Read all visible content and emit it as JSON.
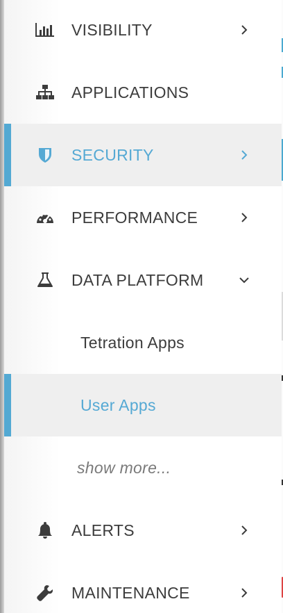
{
  "nav": {
    "items": [
      {
        "label": "VISIBILITY",
        "icon": "bar-chart-icon",
        "chevron": "right"
      },
      {
        "label": "APPLICATIONS",
        "icon": "sitemap-icon",
        "chevron": "none"
      },
      {
        "label": "SECURITY",
        "icon": "shield-icon",
        "chevron": "right",
        "active": true
      },
      {
        "label": "PERFORMANCE",
        "icon": "speedometer-icon",
        "chevron": "right"
      },
      {
        "label": "DATA PLATFORM",
        "icon": "flask-icon",
        "chevron": "down"
      },
      {
        "label": "ALERTS",
        "icon": "bell-icon",
        "chevron": "right"
      },
      {
        "label": "MAINTENANCE",
        "icon": "wrench-icon",
        "chevron": "right"
      }
    ],
    "data_platform_children": [
      {
        "label": "Tetration Apps"
      },
      {
        "label": "User Apps",
        "active": true
      }
    ],
    "show_more": "show more..."
  },
  "colors": {
    "accent": "#55a9d4",
    "active_bg": "#efefef",
    "text": "#3c3c3c",
    "muted": "#7a7a7a"
  }
}
